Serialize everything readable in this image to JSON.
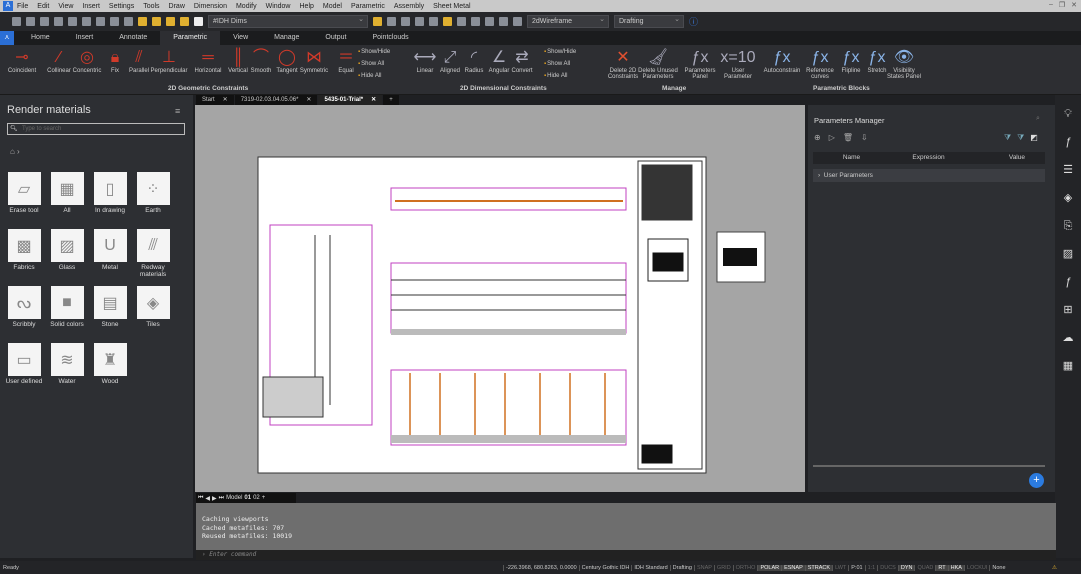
{
  "menu": [
    "File",
    "Edit",
    "View",
    "Insert",
    "Settings",
    "Tools",
    "Draw",
    "Dimension",
    "Modify",
    "Window",
    "Help",
    "Model",
    "Parametric",
    "Assembly",
    "Sheet Metal"
  ],
  "toolbar": {
    "layer": "#IDH Dims",
    "visual_style": "2dWireframe",
    "workspace": "Drafting"
  },
  "ribbon_tabs": [
    "Home",
    "Insert",
    "Annotate",
    "Parametric",
    "View",
    "Manage",
    "Output",
    "Pointclouds"
  ],
  "active_ribbon_tab": "Parametric",
  "geometric": {
    "group": "2D Geometric Constraints",
    "buttons": [
      "Coincident",
      "Collinear",
      "Concentric",
      "Fix",
      "Parallel",
      "Perpendicular",
      "Horizontal",
      "Vertical",
      "Smooth",
      "Tangent",
      "Symmetric",
      "Equal"
    ],
    "small": [
      "Show/Hide",
      "Show All",
      "Hide All"
    ]
  },
  "dimensional": {
    "group": "2D Dimensional Constraints",
    "buttons": [
      "Linear",
      "Aligned",
      "Radius",
      "Angular",
      "Convert"
    ],
    "small": [
      "Show/Hide",
      "Show All",
      "Hide All"
    ]
  },
  "manage": {
    "group": "Manage",
    "buttons": [
      "Delete 2D Constraints",
      "Delete Unused Parameters",
      "Parameters Panel",
      "User Parameter"
    ]
  },
  "blocks": {
    "group": "Parametric Blocks",
    "buttons": [
      "Autoconstrain",
      "Reference curves",
      "Flipline",
      "Stretch",
      "Visibility States Panel"
    ]
  },
  "doc_tabs": [
    "Start",
    "7319-02.03.04.05.06*",
    "5435-01-Trial*"
  ],
  "active_doc": "5435-01-Trial*",
  "left_panel": {
    "title": "Render materials",
    "search_placeholder": "Type to search",
    "materials": [
      {
        "label": "Erase tool",
        "icon": "eraser-icon"
      },
      {
        "label": "All",
        "icon": "grid-icon"
      },
      {
        "label": "In drawing",
        "icon": "document-icon"
      },
      {
        "label": "Earth",
        "icon": "earth-icon"
      },
      {
        "label": "Fabrics",
        "icon": "fabric-icon"
      },
      {
        "label": "Glass",
        "icon": "glass-icon"
      },
      {
        "label": "Metal",
        "icon": "magnet-icon"
      },
      {
        "label": "Redway materials",
        "icon": "redway-icon"
      },
      {
        "label": "Scribbly",
        "icon": "scribble-icon"
      },
      {
        "label": "Solid colors",
        "icon": "solid-icon"
      },
      {
        "label": "Stone",
        "icon": "brick-icon"
      },
      {
        "label": "Tiles",
        "icon": "tiles-icon"
      },
      {
        "label": "User defined",
        "icon": "folder-icon"
      },
      {
        "label": "Water",
        "icon": "water-icon"
      },
      {
        "label": "Wood",
        "icon": "wood-icon"
      }
    ]
  },
  "params": {
    "title": "Parameters Manager",
    "columns": [
      "Name",
      "Expression",
      "Value"
    ],
    "rows": [
      "User Parameters"
    ]
  },
  "layout_tabs": {
    "model": "Model",
    "layouts": [
      "01",
      "02"
    ]
  },
  "command": {
    "lines": [
      "Caching viewports",
      "Cached metafiles: 707",
      "Reused metafiles: 10019"
    ],
    "placeholder": "Enter command"
  },
  "status": {
    "ready": "Ready",
    "coords": "-226.3968, 680.8263, 0.0000",
    "items": [
      "Century Gothic IDH",
      "IDH Standard",
      "Drafting",
      "SNAP",
      "GRID",
      "ORTHO",
      "POLAR",
      "ESNAP",
      "STRACK",
      "LWT",
      "P:01",
      "1:1",
      "DUCS",
      "DYN",
      "QUAD",
      "RT",
      "HKA",
      "LOCKUI",
      "None"
    ],
    "on": [
      "POLAR",
      "ESNAP",
      "STRACK",
      "DYN",
      "RT",
      "HKA"
    ],
    "off": [
      "SNAP",
      "GRID",
      "ORTHO",
      "LWT",
      "1:1",
      "DUCS",
      "QUAD",
      "LOCKUI"
    ]
  },
  "colors": {
    "accent": "#2b6fd6",
    "constraint_red": "#d03a2a",
    "canvas": "#a5a5a5"
  }
}
